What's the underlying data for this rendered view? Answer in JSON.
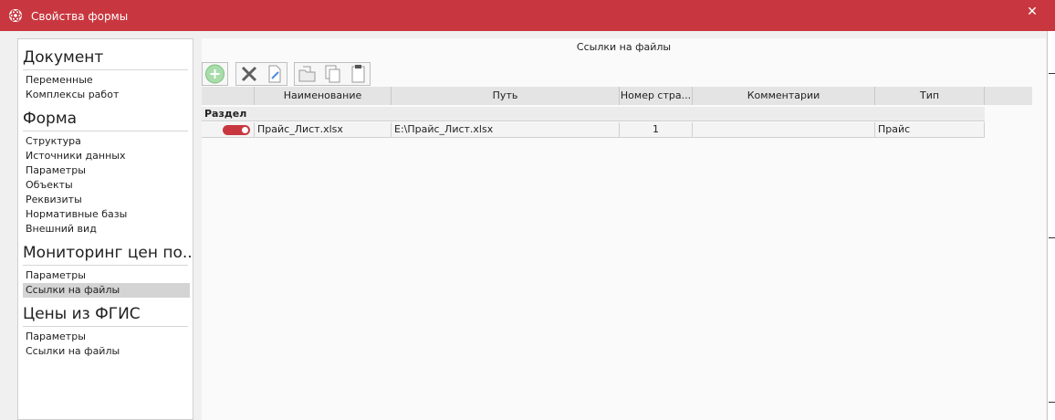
{
  "window": {
    "title": "Свойства формы",
    "close_glyph": "✕",
    "accent_color": "#c8373f"
  },
  "sidebar": {
    "sections": [
      {
        "title": "Документ",
        "items": [
          "Переменные",
          "Комплексы работ"
        ]
      },
      {
        "title": "Форма",
        "items": [
          "Структура",
          "Источники данных",
          "Параметры",
          "Объекты",
          "Реквизиты",
          "Нормативные базы",
          "Внешний вид"
        ]
      },
      {
        "title": "Мониторинг цен по...",
        "items": [
          "Параметры",
          "Ссылки на файлы"
        ]
      },
      {
        "title": "Цены из ФГИС",
        "items": [
          "Параметры",
          "Ссылки на файлы"
        ]
      }
    ],
    "selected": "Мониторинг цен по... / Ссылки на файлы"
  },
  "content": {
    "title": "Ссылки на файлы",
    "toolbar": [
      "add-icon",
      "delete-icon",
      "edit-icon",
      "open-folder-icon",
      "copy-icon",
      "paste-icon"
    ],
    "columns": [
      "Наименование",
      "Путь",
      "Номер стра...",
      "Комментарии",
      "Тип"
    ],
    "group_label": "Раздел",
    "rows": [
      {
        "enabled": true,
        "name": "Прайс_Лист.xlsx",
        "path": "E:\\Прайс_Лист.xlsx",
        "page": "1",
        "comment": "",
        "type": "Прайс"
      }
    ]
  }
}
